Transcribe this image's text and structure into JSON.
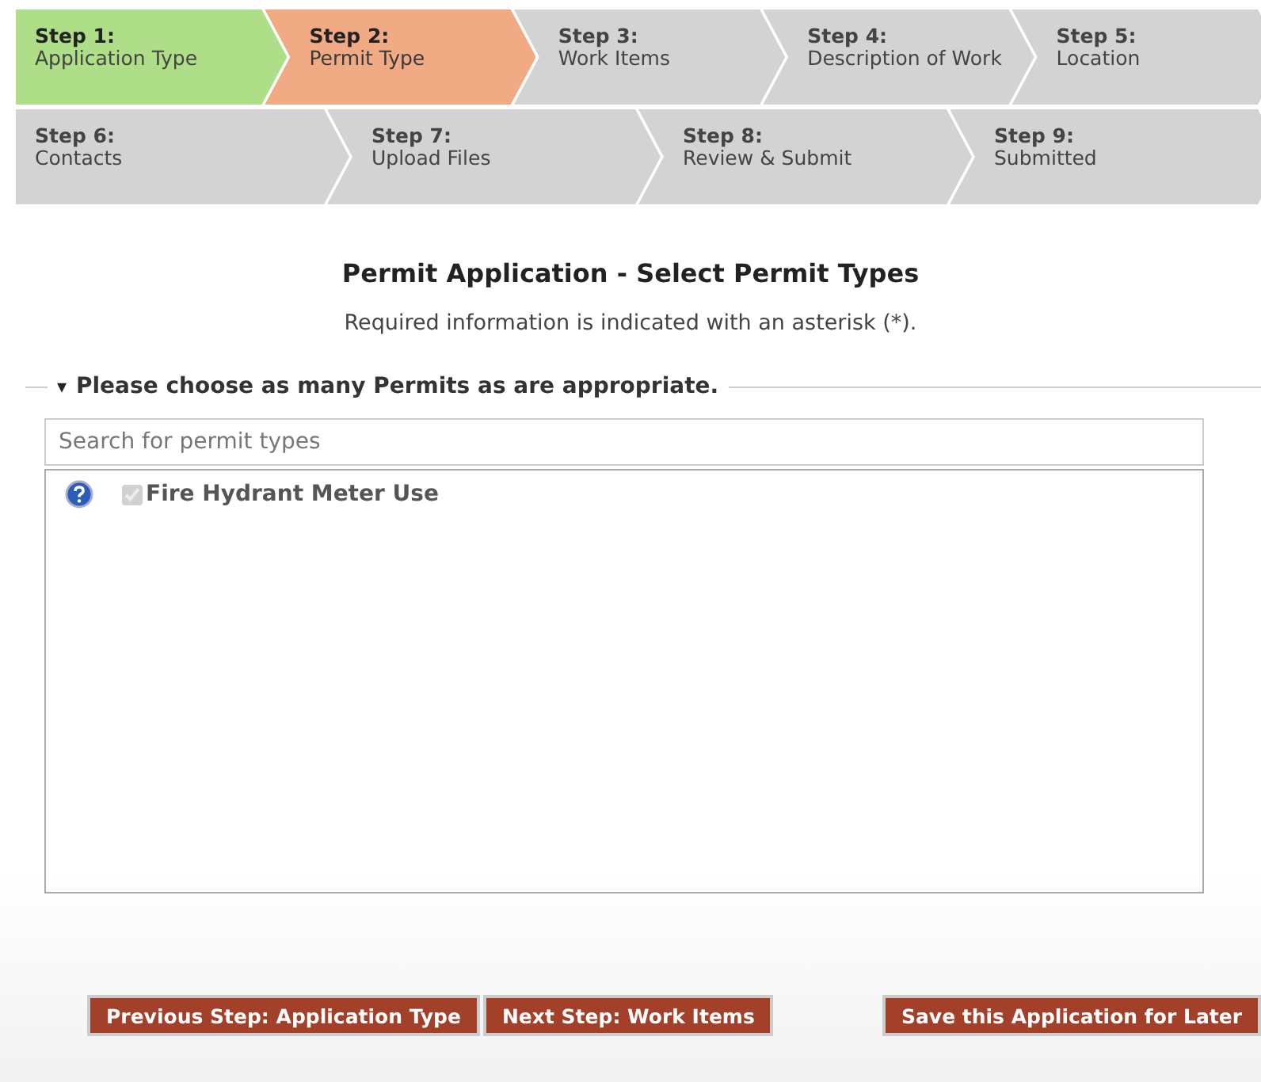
{
  "steps": [
    {
      "number": "Step 1:",
      "label": "Application Type",
      "completed": true,
      "selected": false
    },
    {
      "number": "Step 2:",
      "label": "Permit Type",
      "completed": false,
      "selected": true
    },
    {
      "number": "Step 3:",
      "label": "Work Items",
      "completed": false,
      "selected": false
    },
    {
      "number": "Step 4:",
      "label": "Description of Work",
      "completed": false,
      "selected": false
    },
    {
      "number": "Step 5:",
      "label": "Location",
      "completed": false,
      "selected": false
    },
    {
      "number": "Step 6:",
      "label": "Contacts",
      "completed": false,
      "selected": false
    },
    {
      "number": "Step 7:",
      "label": "Upload Files",
      "completed": false,
      "selected": false
    },
    {
      "number": "Step 8:",
      "label": "Review & Submit",
      "completed": false,
      "selected": false
    },
    {
      "number": "Step 9:",
      "label": "Submitted",
      "completed": false,
      "selected": false
    }
  ],
  "title": "Permit Application - Select Permit Types",
  "note": "Required information is indicated with an asterisk (*).",
  "section": {
    "toggle": "▾",
    "legend": "Please choose as many Permits as are appropriate.",
    "expanded": true
  },
  "search": {
    "placeholder": "Search for permit types"
  },
  "permits": [
    {
      "label": "Fire Hydrant Meter Use",
      "checked": true,
      "disabled": true
    }
  ],
  "buttons": [
    {
      "label": "Previous Step: Application Type",
      "kind": "nav"
    },
    {
      "label": "Next Step: Work Items",
      "kind": "nav"
    },
    {
      "label": "Save this Application for Later",
      "kind": "save"
    }
  ]
}
